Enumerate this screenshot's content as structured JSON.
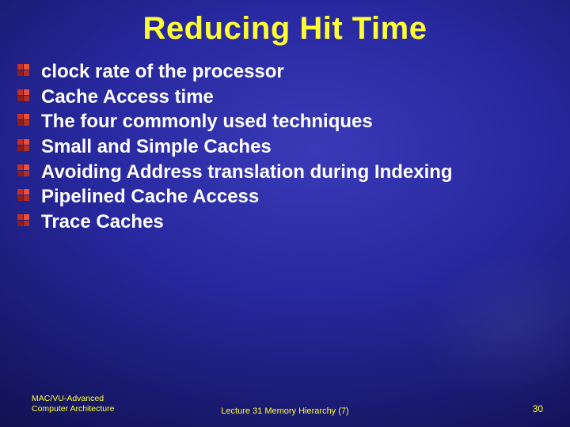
{
  "title": "Reducing Hit Time",
  "bullets": [
    "clock rate of the processor",
    "Cache Access time",
    "The four commonly used techniques",
    "Small and Simple Caches",
    "Avoiding Address translation during Indexing",
    "Pipelined Cache Access",
    "Trace Caches"
  ],
  "footer": {
    "left_line1": "MAC/VU-Advanced",
    "left_line2": "Computer Architecture",
    "center": "Lecture 31 Memory Hierarchy (7)",
    "page": "30"
  },
  "colors": {
    "title": "#ffff33",
    "text": "#ffffff",
    "footer": "#ffff33",
    "bullet_red": "#c0302a"
  }
}
